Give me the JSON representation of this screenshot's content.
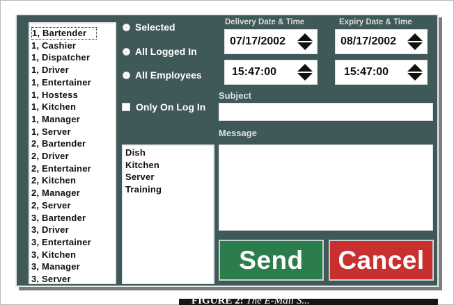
{
  "employee_list": [
    "1, Bartender",
    "1, Cashier",
    "1, Dispatcher",
    "1, Driver",
    "1, Entertainer",
    "1, Hostess",
    "1, Kitchen",
    "1, Manager",
    "1, Server",
    "2, Bartender",
    "2, Driver",
    "2, Entertainer",
    "2, Kitchen",
    "2, Manager",
    "2, Server",
    "3, Bartender",
    "3, Driver",
    "3, Entertainer",
    "3, Kitchen",
    "3, Manager",
    "3, Server"
  ],
  "recipient_options": {
    "selected_label": "Selected",
    "all_logged_in_label": "All Logged In",
    "all_employees_label": "All Employees"
  },
  "only_on_log_in_label": "Only On Log In",
  "group_list": [
    "Dish",
    "Kitchen",
    "Server",
    "Training"
  ],
  "delivery": {
    "label": "Delivery Date & Time",
    "date": "07/17/2002",
    "time": "15:47:00"
  },
  "expiry": {
    "label": "Expiry Date & Time",
    "date": "08/17/2002",
    "time": "15:47:00"
  },
  "subject": {
    "label": "Subject",
    "value": ""
  },
  "message": {
    "label": "Message",
    "value": ""
  },
  "buttons": {
    "send": "Send",
    "cancel": "Cancel"
  },
  "caption": {
    "figure": "FIGURE 2:",
    "title": "The E-Mail S..."
  },
  "colors": {
    "panel_bg": "#3f5858",
    "send_bg": "#2b7d4b",
    "cancel_bg": "#c92f2f"
  }
}
